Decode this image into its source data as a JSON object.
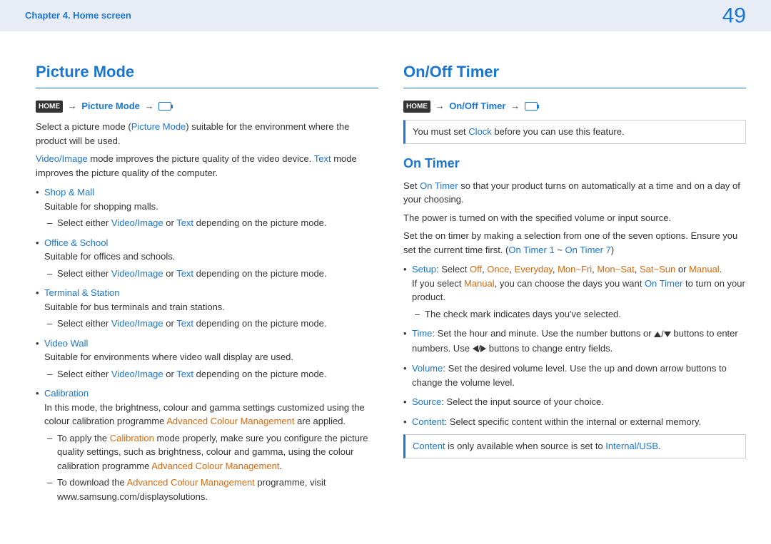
{
  "header": {
    "chapter": "Chapter 4. Home screen",
    "page": "49"
  },
  "left": {
    "title": "Picture Mode",
    "nav": {
      "home": "HOME",
      "link": "Picture Mode"
    },
    "p1_a": "Select a picture mode (",
    "p1_b": "Picture Mode",
    "p1_c": ") suitable for the environment where the product will be used.",
    "p2_a": "Video/Image",
    "p2_b": " mode improves the picture quality of the video device. ",
    "p2_c": "Text",
    "p2_d": " mode improves the picture quality of the computer.",
    "items": [
      {
        "title": "Shop & Mall",
        "desc": "Suitable for shopping malls.",
        "sub_a": "Select either ",
        "sub_b": "Video/Image",
        "sub_c": " or ",
        "sub_d": "Text",
        "sub_e": " depending on the picture mode."
      },
      {
        "title": "Office & School",
        "desc": "Suitable for offices and schools.",
        "sub_a": "Select either ",
        "sub_b": "Video/Image",
        "sub_c": " or ",
        "sub_d": "Text",
        "sub_e": " depending on the picture mode."
      },
      {
        "title": "Terminal & Station",
        "desc": "Suitable for bus terminals and train stations.",
        "sub_a": "Select either ",
        "sub_b": "Video/Image",
        "sub_c": " or ",
        "sub_d": "Text",
        "sub_e": " depending on the picture mode."
      },
      {
        "title": "Video Wall",
        "desc": "Suitable for environments where video wall display are used.",
        "sub_a": "Select either ",
        "sub_b": "Video/Image",
        "sub_c": " or ",
        "sub_d": "Text",
        "sub_e": " depending on the picture mode."
      }
    ],
    "calib": {
      "title": "Calibration",
      "desc_a": "In this mode, the brightness, colour and gamma settings customized using the colour calibration programme ",
      "desc_b": "Advanced Colour Management",
      "desc_c": " are applied.",
      "sub1_a": "To apply the ",
      "sub1_b": "Calibration",
      "sub1_c": " mode properly, make sure you configure the picture quality settings, such as brightness, colour and gamma, using the colour calibration programme ",
      "sub1_d": "Advanced Colour Management",
      "sub1_e": ".",
      "sub2_a": "To download the ",
      "sub2_b": "Advanced Colour Management",
      "sub2_c": " programme, visit www.samsung.com/displaysolutions."
    }
  },
  "right": {
    "title": "On/Off Timer",
    "nav": {
      "home": "HOME",
      "link": "On/Off Timer"
    },
    "note1_a": "You must set ",
    "note1_b": "Clock",
    "note1_c": " before you can use this feature.",
    "subheading": "On Timer",
    "p1_a": "Set ",
    "p1_b": "On Timer",
    "p1_c": " so that your product turns on automatically at a time and on a day of your choosing.",
    "p2": "The power is turned on with the specified volume or input source.",
    "p3_a": "Set the on timer by making a selection from one of the seven options. Ensure you set the current time first. (",
    "p3_b": "On Timer 1",
    "p3_c": " ~ ",
    "p3_d": "On Timer 7",
    "p3_e": ")",
    "setup": {
      "lbl": "Setup",
      "a": ": Select ",
      "o1": "Off",
      "o2": "Once",
      "o3": "Everyday",
      "o4": "Mon~Fri",
      "o5": "Mon~Sat",
      "o6": "Sat~Sun",
      "o7": "Manual",
      "or": " or ",
      "end": ".",
      "line2_a": "If you select ",
      "line2_b": "Manual",
      "line2_c": ", you can choose the days you want ",
      "line2_d": "On Timer",
      "line2_e": " to turn on your product.",
      "sub": "The check mark indicates days you've selected."
    },
    "time": {
      "lbl": "Time",
      "a": ": Set the hour and minute. Use the number buttons or ",
      "b": " buttons to enter numbers. Use ",
      "c": " buttons to change entry fields."
    },
    "volume": {
      "lbl": "Volume",
      "txt": ": Set the desired volume level. Use the up and down arrow buttons to change the volume level."
    },
    "source": {
      "lbl": "Source",
      "txt": ": Select the input source of your choice."
    },
    "content": {
      "lbl": "Content",
      "txt": ": Select specific content within the internal or external memory."
    },
    "note2_a": "Content",
    "note2_b": " is only available when source is set to ",
    "note2_c": "Internal/USB",
    "note2_d": "."
  }
}
